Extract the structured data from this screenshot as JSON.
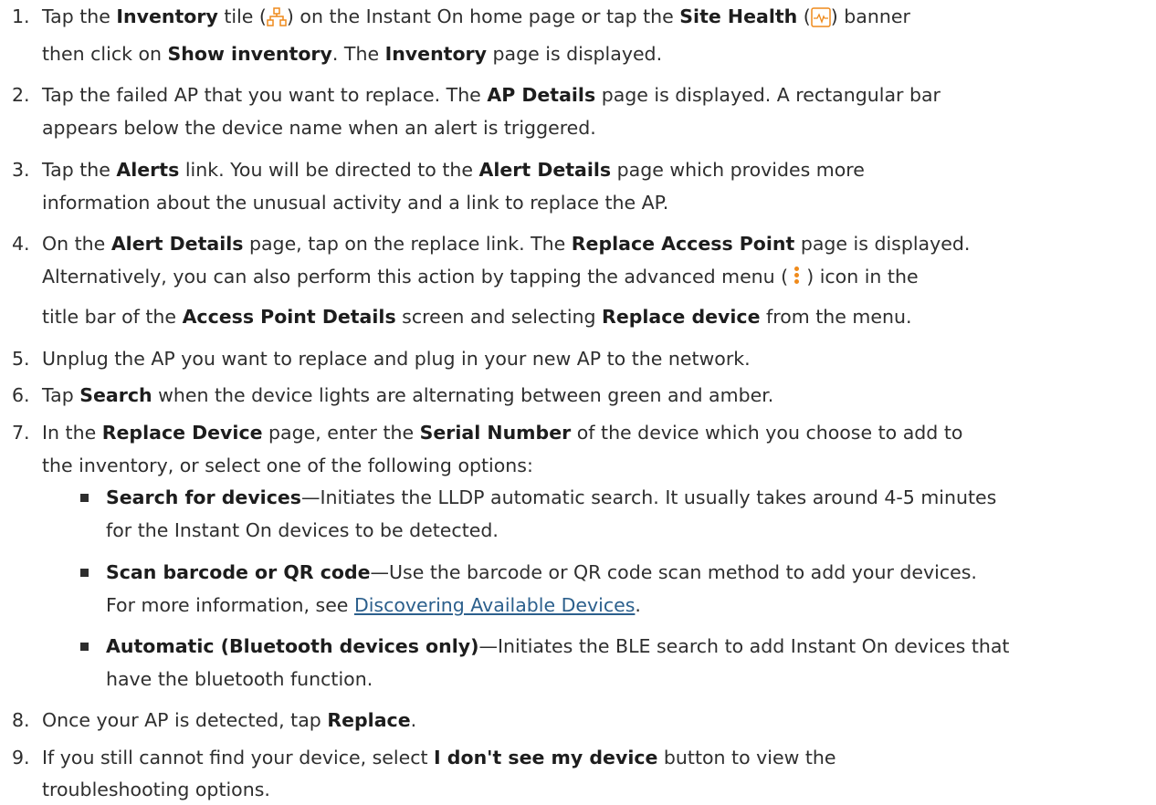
{
  "steps": [
    {
      "num": "1.",
      "lines": [
        {
          "t1": "Tap the ",
          "b1": "Inventory",
          "t2": " tile (",
          "t3": ") on the Instant On home page or tap the ",
          "b2": "Site Health",
          "t4": " (",
          "t5": ") banner"
        },
        {
          "t1": "then click on ",
          "b1": "Show inventory",
          "t2": ". The ",
          "b2": "Inventory",
          "t3": " page is displayed."
        }
      ]
    },
    {
      "num": "2.",
      "lines": [
        {
          "t1": "Tap the failed AP that you want to replace. The ",
          "b1": "AP Details",
          "t2": " page is displayed. A rectangular bar"
        },
        {
          "t1": "appears below the device name when an alert is triggered."
        }
      ]
    },
    {
      "num": "3.",
      "lines": [
        {
          "t1": "Tap the ",
          "b1": "Alerts",
          "t2": " link. You will be directed to the ",
          "b2": "Alert Details",
          "t3": " page which provides more"
        },
        {
          "t1": "information about the unusual activity and a link to replace the AP."
        }
      ]
    },
    {
      "num": "4.",
      "lines": [
        {
          "t1": "On the ",
          "b1": "Alert Details",
          "t2": " page, tap on the replace link. The ",
          "b2": "Replace Access Point",
          "t3": " page is displayed."
        },
        {
          "t1": "Alternatively, you can also perform this action by tapping the advanced menu (",
          "t2": ") icon in the"
        },
        {
          "t1": "title bar of the ",
          "b1": "Access Point Details",
          "t2": " screen and selecting ",
          "b2": "Replace device",
          "t3": " from the menu."
        }
      ]
    },
    {
      "num": "5.",
      "lines": [
        {
          "t1": "Unplug the AP you want to replace and plug in your new AP to the network."
        }
      ]
    },
    {
      "num": "6.",
      "lines": [
        {
          "t1": "Tap ",
          "b1": "Search",
          "t2": " when the device lights are alternating between green and amber."
        }
      ]
    },
    {
      "num": "7.",
      "lines": [
        {
          "t1": "In the ",
          "b1": "Replace Device",
          "t2": " page, enter the ",
          "b2": "Serial Number",
          "t3": " of the device which you choose to add to"
        },
        {
          "t1": "the inventory, or select one of the following options:"
        }
      ]
    },
    {
      "num": "8.",
      "lines": [
        {
          "t1": "Once your AP is detected, tap ",
          "b1": "Replace",
          "t2": "."
        }
      ]
    },
    {
      "num": "9.",
      "lines": [
        {
          "t1": "If you still cannot find your device, select ",
          "b1": "I don't see my device",
          "t2": " button to view the"
        },
        {
          "t1": "troubleshooting options."
        }
      ]
    }
  ],
  "bullets": [
    {
      "l1": {
        "b1": "Search for devices",
        "t1": "—Initiates the LLDP automatic search. It usually takes around 4-5 minutes"
      },
      "l2": {
        "t1": "for the Instant On devices to be detected."
      }
    },
    {
      "l1": {
        "b1": "Scan barcode or QR code",
        "t1": "—Use the barcode or QR code scan method to add your devices."
      },
      "l2": {
        "t1": "For more information, see ",
        "link": "Discovering Available Devices",
        "t2": "."
      }
    },
    {
      "l1": {
        "b1": "Automatic (Bluetooth devices only)",
        "t1": "—Initiates the BLE search to add Instant On devices that"
      },
      "l2": {
        "t1": "have the bluetooth function."
      }
    }
  ],
  "icons": {
    "inventory": "inventory-icon",
    "site_health": "site-health-icon",
    "advanced_menu": "kebab-menu-icon"
  },
  "colors": {
    "accent": "#ef8a1b",
    "link": "#2b5f8c",
    "text": "#2e2e2e"
  }
}
